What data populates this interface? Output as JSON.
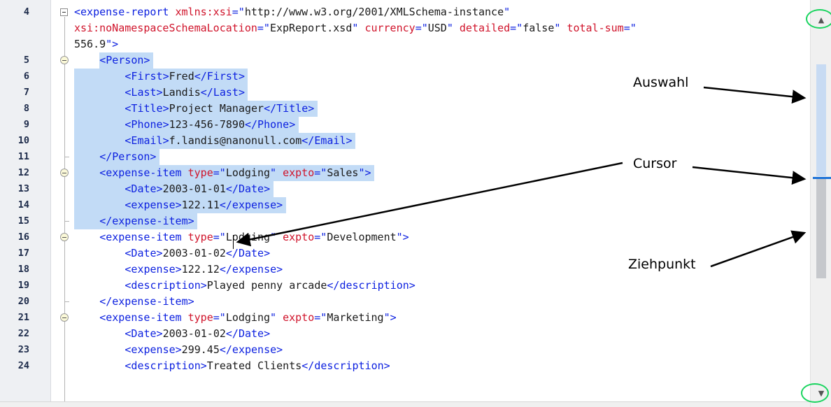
{
  "editor": {
    "line_numbers": [
      "4",
      "",
      "",
      "5",
      "6",
      "7",
      "8",
      "9",
      "10",
      "11",
      "12",
      "13",
      "14",
      "15",
      "16",
      "17",
      "18",
      "19",
      "20",
      "21",
      "22",
      "23",
      "24"
    ],
    "lines": [
      [
        [
          "t",
          "<expense-report "
        ],
        [
          "a",
          "xmlns:xsi"
        ],
        [
          "t",
          "=\""
        ],
        [
          "v",
          "http://www.w3.org/2001/XMLSchema-instance"
        ],
        [
          "t",
          "\""
        ]
      ],
      [
        [
          "a",
          "xsi:noNamespaceSchemaLocation"
        ],
        [
          "t",
          "=\""
        ],
        [
          "v",
          "ExpReport.xsd"
        ],
        [
          "t",
          "\" "
        ],
        [
          "a",
          "currency"
        ],
        [
          "t",
          "=\""
        ],
        [
          "v",
          "USD"
        ],
        [
          "t",
          "\" "
        ],
        [
          "a",
          "detailed"
        ],
        [
          "t",
          "=\""
        ],
        [
          "v",
          "false"
        ],
        [
          "t",
          "\" "
        ],
        [
          "a",
          "total-sum"
        ],
        [
          "t",
          "=\""
        ]
      ],
      [
        [
          "v",
          "556.9"
        ],
        [
          "t",
          "\">"
        ]
      ],
      [
        [
          "t",
          "<Person>"
        ]
      ],
      [
        [
          "t",
          "<First>"
        ],
        [
          "v",
          "Fred"
        ],
        [
          "t",
          "</First>"
        ]
      ],
      [
        [
          "t",
          "<Last>"
        ],
        [
          "v",
          "Landis"
        ],
        [
          "t",
          "</Last>"
        ]
      ],
      [
        [
          "t",
          "<Title>"
        ],
        [
          "v",
          "Project Manager"
        ],
        [
          "t",
          "</Title>"
        ]
      ],
      [
        [
          "t",
          "<Phone>"
        ],
        [
          "v",
          "123-456-7890"
        ],
        [
          "t",
          "</Phone>"
        ]
      ],
      [
        [
          "t",
          "<Email>"
        ],
        [
          "v",
          "f.landis@nanonull.com"
        ],
        [
          "t",
          "</Email>"
        ]
      ],
      [
        [
          "t",
          "</Person>"
        ]
      ],
      [
        [
          "t",
          "<expense-item "
        ],
        [
          "a",
          "type"
        ],
        [
          "t",
          "=\""
        ],
        [
          "v",
          "Lodging"
        ],
        [
          "t",
          "\" "
        ],
        [
          "a",
          "expto"
        ],
        [
          "t",
          "=\""
        ],
        [
          "v",
          "Sales"
        ],
        [
          "t",
          "\">"
        ]
      ],
      [
        [
          "t",
          "<Date>"
        ],
        [
          "v",
          "2003-01-01"
        ],
        [
          "t",
          "</Date>"
        ]
      ],
      [
        [
          "t",
          "<expense>"
        ],
        [
          "v",
          "122.11"
        ],
        [
          "t",
          "</expense>"
        ]
      ],
      [
        [
          "t",
          "</expense-item>"
        ]
      ],
      [
        [
          "t",
          "<expense-item "
        ],
        [
          "a",
          "type"
        ],
        [
          "t",
          "=\""
        ],
        [
          "v",
          "Lodging"
        ],
        [
          "t",
          "\" "
        ],
        [
          "a",
          "expto"
        ],
        [
          "t",
          "=\""
        ],
        [
          "v",
          "Development"
        ],
        [
          "t",
          "\">"
        ]
      ],
      [
        [
          "t",
          "<Date>"
        ],
        [
          "v",
          "2003-01-02"
        ],
        [
          "t",
          "</Date>"
        ]
      ],
      [
        [
          "t",
          "<expense>"
        ],
        [
          "v",
          "122.12"
        ],
        [
          "t",
          "</expense>"
        ]
      ],
      [
        [
          "t",
          "<description>"
        ],
        [
          "v",
          "Played penny arcade"
        ],
        [
          "t",
          "</description>"
        ]
      ],
      [
        [
          "t",
          "</expense-item>"
        ]
      ],
      [
        [
          "t",
          "<expense-item "
        ],
        [
          "a",
          "type"
        ],
        [
          "t",
          "=\""
        ],
        [
          "v",
          "Lodging"
        ],
        [
          "t",
          "\" "
        ],
        [
          "a",
          "expto"
        ],
        [
          "t",
          "=\""
        ],
        [
          "v",
          "Marketing"
        ],
        [
          "t",
          "\">"
        ]
      ],
      [
        [
          "t",
          "<Date>"
        ],
        [
          "v",
          "2003-01-02"
        ],
        [
          "t",
          "</Date>"
        ]
      ],
      [
        [
          "t",
          "<expense>"
        ],
        [
          "v",
          "299.45"
        ],
        [
          "t",
          "</expense>"
        ]
      ],
      [
        [
          "t",
          "<description>"
        ],
        [
          "v",
          "Treated Clients"
        ],
        [
          "t",
          "</description>"
        ]
      ]
    ]
  },
  "annotations": {
    "selection_label": "Auswahl",
    "cursor_label": "Cursor",
    "handle_label": "Ziehpunkt"
  },
  "scrollbar": {
    "up_icon": "▲",
    "down_icon": "▼",
    "highlight_color": "#18d45e"
  }
}
